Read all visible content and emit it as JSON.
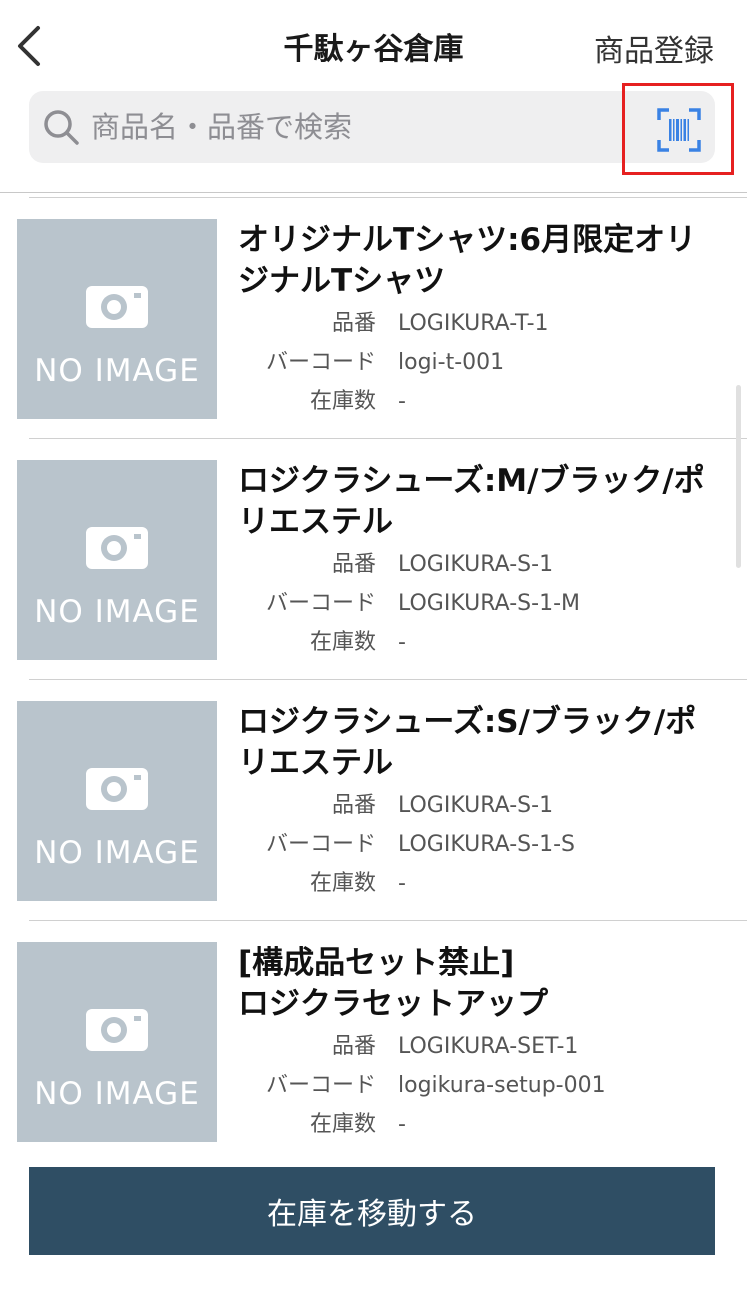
{
  "header": {
    "title": "千駄ヶ谷倉庫",
    "register_label": "商品登録"
  },
  "search": {
    "placeholder": "商品名・品番で検索",
    "value": ""
  },
  "labels": {
    "sku": "品番",
    "barcode": "バーコード",
    "stock": "在庫数"
  },
  "no_image_label": "NO IMAGE",
  "products": [
    {
      "name": "オリジナルTシャツ:6月限定オリジナルTシャツ",
      "sku": "LOGIKURA-T-1",
      "barcode": "logi-t-001",
      "stock": "-"
    },
    {
      "name": "ロジクラシューズ:M/ブラック/ポリエステル",
      "sku": "LOGIKURA-S-1",
      "barcode": "LOGIKURA-S-1-M",
      "stock": "-"
    },
    {
      "name": "ロジクラシューズ:S/ブラック/ポリエステル",
      "sku": "LOGIKURA-S-1",
      "barcode": "LOGIKURA-S-1-S",
      "stock": "-"
    },
    {
      "name": "[構成品セット禁止]\nロジクラセットアップ",
      "sku": "LOGIKURA-SET-1",
      "barcode": "logikura-setup-001",
      "stock": "-"
    }
  ],
  "footer": {
    "move_stock_label": "在庫を移動する"
  },
  "colors": {
    "accent": "#2f4e64",
    "barcode_icon": "#3a82e4",
    "highlight": "#e62020",
    "thumb_bg": "#b9c4cc"
  },
  "icons": {
    "back": "chevron-left-icon",
    "search": "magnifier-icon",
    "scan": "barcode-scan-icon",
    "thumbnail": "camera-icon"
  }
}
